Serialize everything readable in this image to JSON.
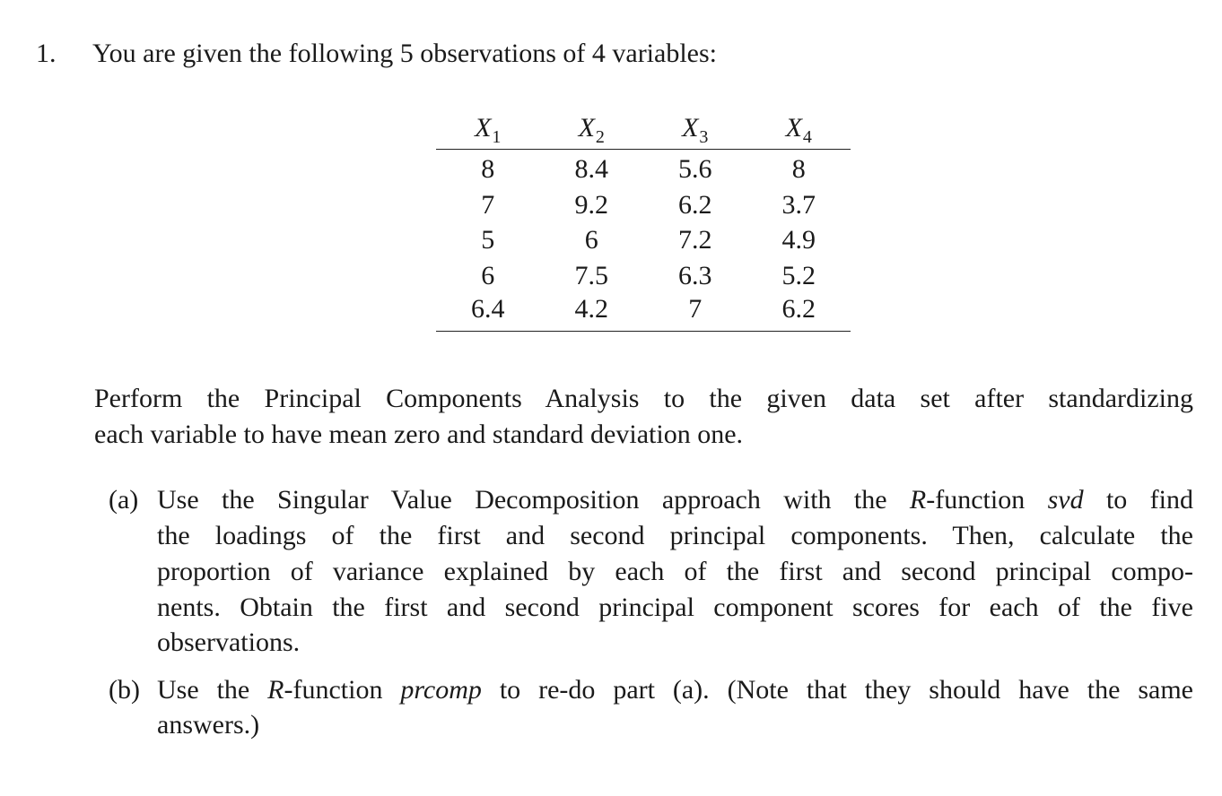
{
  "question": {
    "number": "1.",
    "intro": "You are given the following 5 observations of 4 variables:"
  },
  "table": {
    "headers": [
      {
        "var": "X",
        "sub": "1"
      },
      {
        "var": "X",
        "sub": "2"
      },
      {
        "var": "X",
        "sub": "3"
      },
      {
        "var": "X",
        "sub": "4"
      }
    ],
    "rows": [
      [
        "8",
        "8.4",
        "5.6",
        "8"
      ],
      [
        "7",
        "9.2",
        "6.2",
        "3.7"
      ],
      [
        "5",
        "6",
        "7.2",
        "4.9"
      ],
      [
        "6",
        "7.5",
        "6.3",
        "5.2"
      ],
      [
        "6.4",
        "4.2",
        "7",
        "6.2"
      ]
    ]
  },
  "instruction": {
    "line1": "Perform the Principal Components Analysis to the given data set after standardizing",
    "line2": "each variable to have mean zero and standard deviation one."
  },
  "part_a": {
    "label": "(a)",
    "l1_pre": "Use the Singular Value Decomposition approach with the ",
    "l1_r": "R",
    "l1_mid": "-function ",
    "l1_fn": "svd",
    "l1_post": " to find",
    "line2": "the loadings of the first and second principal components.  Then, calculate the",
    "line3": "proportion of variance explained by each of the first and second principal compo-",
    "line4": "nents. Obtain the first and second principal component scores for each of the five",
    "line5": "observations."
  },
  "part_b": {
    "label": "(b)",
    "l1_pre": "Use the ",
    "l1_r": "R",
    "l1_mid": "-function ",
    "l1_fn": "prcomp",
    "l1_post": " to re-do part (a).  (Note that they should have the same",
    "line2": "answers.)"
  }
}
